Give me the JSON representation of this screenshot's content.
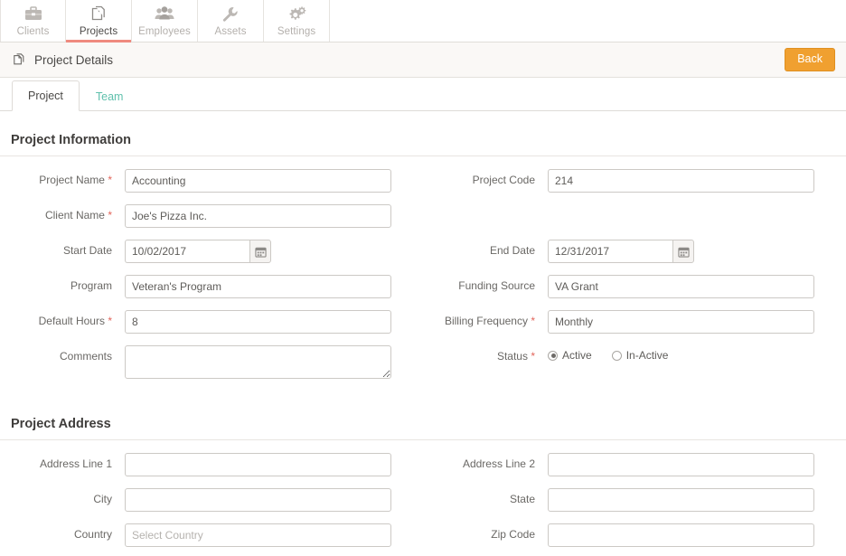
{
  "topnav": {
    "items": [
      {
        "label": "Clients",
        "icon": "briefcase-icon",
        "active": false
      },
      {
        "label": "Projects",
        "icon": "documents-icon",
        "active": true
      },
      {
        "label": "Employees",
        "icon": "people-icon",
        "active": false
      },
      {
        "label": "Assets",
        "icon": "wrench-icon",
        "active": false
      },
      {
        "label": "Settings",
        "icon": "gears-icon",
        "active": false
      }
    ],
    "active_indicator_color": "#ef8a7f"
  },
  "pagehead": {
    "icon": "documents-icon",
    "title": "Project Details",
    "back_label": "Back",
    "back_color": "#f0a030"
  },
  "subtabs": {
    "project_label": "Project",
    "team_label": "Team",
    "team_color": "#5fc0ac"
  },
  "sections": {
    "project_information": {
      "title": "Project Information",
      "project_name": {
        "label": "Project Name",
        "required": "*",
        "value": "Accounting",
        "placeholder": ""
      },
      "project_code": {
        "label": "Project Code",
        "required": "",
        "value": "214",
        "placeholder": ""
      },
      "client_name": {
        "label": "Client Name",
        "required": "*",
        "value": "Joe's Pizza Inc.",
        "placeholder": ""
      },
      "start_date": {
        "label": "Start Date",
        "required": "",
        "value": "10/02/2017",
        "placeholder": "",
        "icon": "calendar-icon"
      },
      "end_date": {
        "label": "End Date",
        "required": "",
        "value": "12/31/2017",
        "placeholder": "",
        "icon": "calendar-icon"
      },
      "program": {
        "label": "Program",
        "required": "",
        "value": "Veteran's Program",
        "placeholder": ""
      },
      "funding_source": {
        "label": "Funding Source",
        "required": "",
        "value": "VA Grant",
        "placeholder": ""
      },
      "default_hours": {
        "label": "Default Hours",
        "required": "*",
        "value": "8",
        "placeholder": ""
      },
      "billing_frequency": {
        "label": "Billing Frequency",
        "required": "*",
        "value": "Monthly",
        "placeholder": ""
      },
      "comments": {
        "label": "Comments",
        "required": "",
        "value": "",
        "placeholder": ""
      },
      "status": {
        "label": "Status",
        "required": "*",
        "selected": "Active",
        "options": [
          {
            "label": "Active",
            "checked": true
          },
          {
            "label": "In-Active",
            "checked": false
          }
        ]
      }
    },
    "project_address": {
      "title": "Project Address",
      "address_line_1": {
        "label": "Address Line 1",
        "required": "",
        "value": "",
        "placeholder": ""
      },
      "address_line_2": {
        "label": "Address Line 2",
        "required": "",
        "value": "",
        "placeholder": ""
      },
      "city": {
        "label": "City",
        "required": "",
        "value": "",
        "placeholder": ""
      },
      "state": {
        "label": "State",
        "required": "",
        "value": "",
        "placeholder": ""
      },
      "country": {
        "label": "Country",
        "required": "",
        "value": "",
        "placeholder": "Select Country"
      },
      "zip_code": {
        "label": "Zip Code",
        "required": "",
        "value": "",
        "placeholder": ""
      }
    }
  }
}
